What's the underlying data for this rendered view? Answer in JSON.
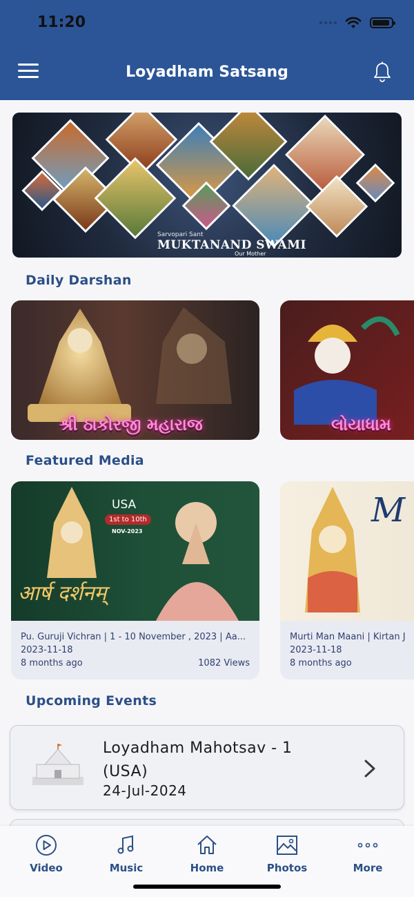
{
  "status_bar": {
    "time": "11:20"
  },
  "header": {
    "title": "Loyadham Satsang"
  },
  "banner": {
    "small_text": "Sarvopari Sant",
    "big_text": "MUKTANAND SWAMI",
    "sub_text": "Our Mother"
  },
  "sections": {
    "daily_darshan": "Daily Darshan",
    "featured_media": "Featured Media",
    "upcoming_events": "Upcoming Events"
  },
  "darshan": [
    {
      "caption": "શ્રી ઠાકોરજી મહારાજ"
    },
    {
      "caption": "લોયાધામ"
    }
  ],
  "media": [
    {
      "poster_text_1": "USA",
      "poster_text_2": "1st to 10th",
      "poster_text_3": "NOV-2023",
      "poster_text_4": "आर्ष दर्शनम्",
      "title": "Pu. Guruji Vichran | 1 - 10 November , 2023 | Aa...",
      "date": "2023-11-18",
      "ago": "8 months ago",
      "views": "1082 Views"
    },
    {
      "poster_text_1": "M",
      "title": "Murti Man Maani | Kirtan J",
      "date": "2023-11-18",
      "ago": "8 months ago",
      "views": ""
    }
  ],
  "event": {
    "title": "Loyadham Mahotsav - 1 (USA)",
    "date": "24-Jul-2024"
  },
  "tabs": [
    {
      "label": "Video",
      "icon": "play-circle-icon"
    },
    {
      "label": "Music",
      "icon": "music-note-icon"
    },
    {
      "label": "Home",
      "icon": "home-icon"
    },
    {
      "label": "Photos",
      "icon": "image-icon"
    },
    {
      "label": "More",
      "icon": "more-dots-icon"
    }
  ],
  "colors": {
    "header": "#2b5597",
    "accent": "#2b4f86",
    "background": "#f6f6f9"
  }
}
